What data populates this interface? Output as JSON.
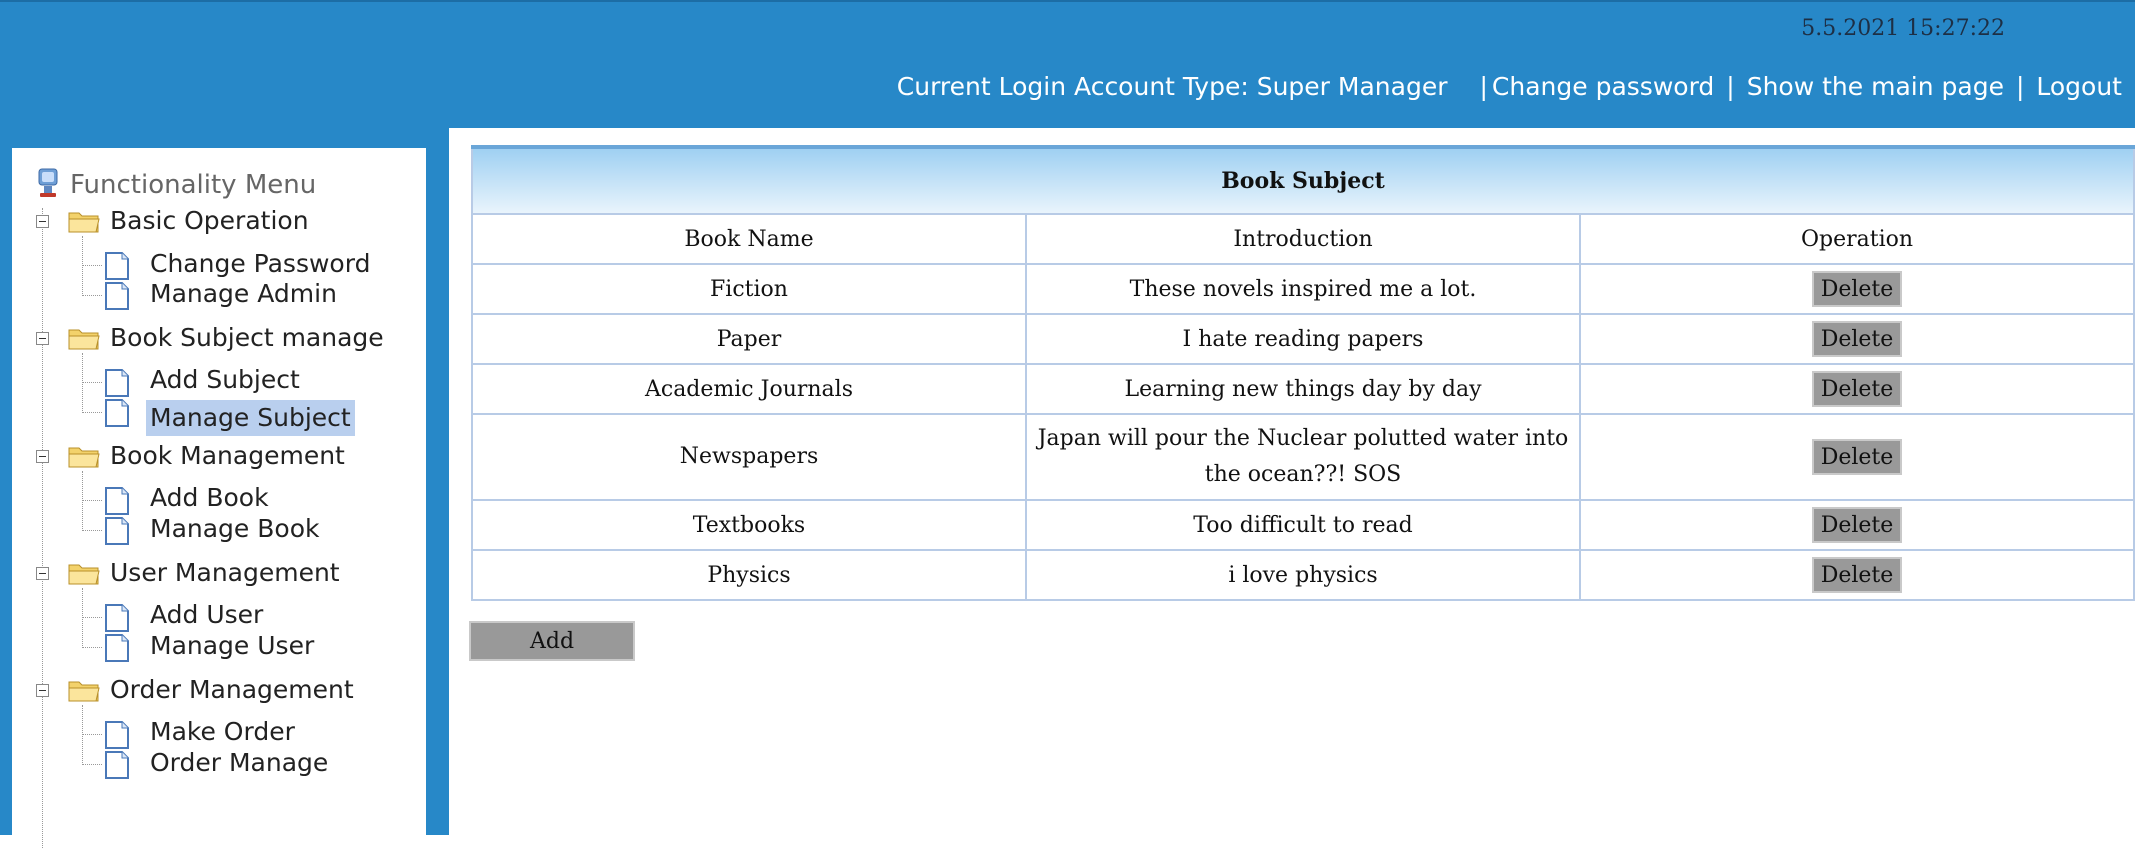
{
  "header": {
    "datetime": "5.5.2021 15:27:22",
    "account_text": "Current Login Account Type: Super Manager",
    "links": [
      "Change password",
      "Show the main page",
      "Logout"
    ]
  },
  "sidebar": {
    "title": "Functionality Menu",
    "groups": [
      {
        "label": "Basic Operation",
        "items": [
          "Change Password",
          "Manage Admin"
        ]
      },
      {
        "label": "Book Subject manage",
        "items": [
          "Add Subject",
          "Manage Subject"
        ]
      },
      {
        "label": "Book Management",
        "items": [
          "Add Book",
          "Manage Book"
        ]
      },
      {
        "label": "User Management",
        "items": [
          "Add User",
          "Manage User"
        ]
      },
      {
        "label": "Order Management",
        "items": [
          "Make Order",
          "Order Manage"
        ]
      }
    ],
    "active_item": "Manage Subject"
  },
  "table": {
    "caption": "Book Subject",
    "columns": [
      "Book Name",
      "Introduction",
      "Operation"
    ],
    "rows": [
      {
        "name": "Fiction",
        "intro": "These novels inspired me a lot.",
        "op": "Delete"
      },
      {
        "name": "Paper",
        "intro": "I hate reading papers",
        "op": "Delete"
      },
      {
        "name": "Academic Journals",
        "intro": "Learning new things day by day",
        "op": "Delete"
      },
      {
        "name": "Newspapers",
        "intro": "Japan will pour the Nuclear polutted water into the ocean??! SOS",
        "op": "Delete"
      },
      {
        "name": "Textbooks",
        "intro": "Too difficult to read",
        "op": "Delete"
      },
      {
        "name": "Physics",
        "intro": "i love physics",
        "op": "Delete"
      }
    ]
  },
  "add_label": "Add",
  "colors": {
    "header_bg": "#2788c8",
    "active_item_bg": "#b9cfee",
    "button_bg": "#999999"
  }
}
